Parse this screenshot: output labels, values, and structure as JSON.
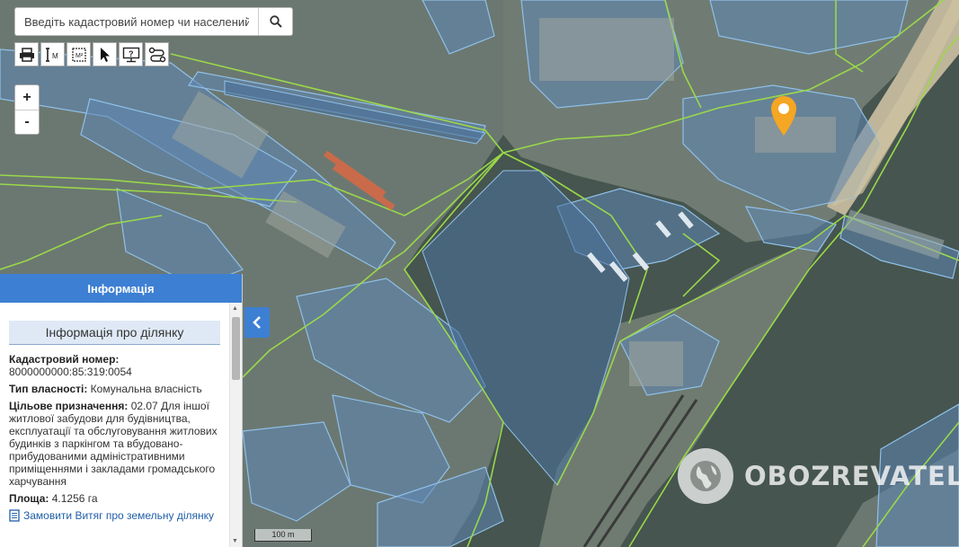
{
  "search": {
    "placeholder": "Введіть кадастровий номер чи населений"
  },
  "toolbar": {
    "tools": [
      {
        "name": "print-icon"
      },
      {
        "name": "measure-length-icon",
        "label": "M"
      },
      {
        "name": "measure-area-icon",
        "label": "M²"
      },
      {
        "name": "select-pointer-icon"
      },
      {
        "name": "help-icon",
        "label": "?"
      },
      {
        "name": "route-icon"
      }
    ]
  },
  "zoom": {
    "in": "+",
    "out": "-"
  },
  "panel": {
    "header": "Інформація",
    "title": "Інформація про ділянку",
    "cadastral_label": "Кадастровий номер:",
    "cadastral_value": "8000000000:85:319:0054",
    "ownership_label": "Тип власності:",
    "ownership_value": "Комунальна власність",
    "purpose_label": "Цільове призначення:",
    "purpose_value": "02.07 Для іншої житлової забудови для будівництва, експлуатації та обслуговування житлових будинків з паркінгом та вбудовано-прибудованими адміністративними приміщеннями і закладами громадського харчування",
    "area_label": "Площа:",
    "area_value": "4.1256 га",
    "order_link": "Замовити Витяг про земельну ділянку"
  },
  "scale": {
    "label": "100 m"
  },
  "watermark": {
    "text": "OBOZREVATEL"
  },
  "colors": {
    "water": "#46554f",
    "land": "#6d7a73",
    "parcel_fill": "#5f86b5",
    "parcel_stroke": "#8fc0ea",
    "boundary": "#9ad84a",
    "panel_header": "#3d7fd3",
    "marker": "#f5a623"
  }
}
